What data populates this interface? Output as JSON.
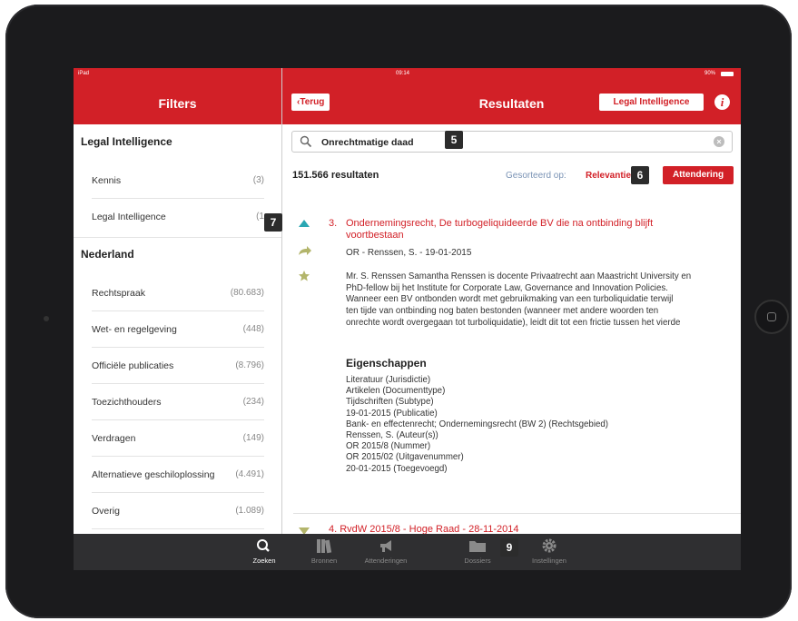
{
  "status": {
    "device": "iPad",
    "time": "09:14",
    "battery": "90%"
  },
  "left": {
    "title": "Filters",
    "sections": [
      {
        "heading": "Legal Intelligence",
        "items": [
          {
            "label": "Kennis",
            "count": "(3)"
          },
          {
            "label": "Legal Intelligence",
            "count": "(1"
          }
        ]
      },
      {
        "heading": "Nederland",
        "items": [
          {
            "label": "Rechtspraak",
            "count": "(80.683)"
          },
          {
            "label": "Wet- en regelgeving",
            "count": "(448)"
          },
          {
            "label": "Officiële publicaties",
            "count": "(8.796)"
          },
          {
            "label": "Toezichthouders",
            "count": "(234)"
          },
          {
            "label": "Verdragen",
            "count": "(149)"
          },
          {
            "label": "Alternatieve geschiloplossing",
            "count": "(4.491)"
          },
          {
            "label": "Overig",
            "count": "(1.089)"
          }
        ]
      }
    ]
  },
  "header": {
    "back": "‹Terug",
    "title": "Resultaten",
    "legal_intelligence": "Legal Intelligence",
    "info": "i"
  },
  "search": {
    "value": "Onrechtmatige daad"
  },
  "results": {
    "count": "151.566 resultaten",
    "sorted_label": "Gesorteerd op:",
    "sorted_value": "Relevantie",
    "attendering": "Attendering",
    "item": {
      "number": "3.",
      "title": "Ondernemingsrecht, De turbogeliquideerde BV die na ontbinding blijft voortbestaan",
      "meta": "OR - Renssen, S. - 19-01-2015",
      "snippet": [
        "Mr. S. Renssen Samantha Renssen is docente Privaatrecht aan Maastricht University en",
        "PhD-fellow bij het Institute for Corporate Law, Governance and Innovation Policies.",
        "Wanneer een BV ontbonden wordt met gebruikmaking van een turboliquidatie terwijl",
        "ten tijde van ontbinding nog baten bestonden (wanneer met andere woorden ten",
        "onrechte wordt overgegaan tot turboliquidatie), leidt dit tot een frictie tussen het vierde"
      ],
      "properties_heading": "Eigenschappen",
      "properties": [
        "Literatuur (Jurisdictie)",
        "Artikelen (Documenttype)",
        "Tijdschriften (Subtype)",
        "19-01-2015 (Publicatie)",
        "Bank- en effectenrecht; Ondernemingsrecht (BW 2) (Rechtsgebied)",
        "Renssen, S. (Auteur(s))",
        "OR 2015/8 (Nummer)",
        "OR 2015/02 (Uitgavenummer)",
        "20-01-2015 (Toegevoegd)"
      ]
    },
    "next_item": "4.  RvdW 2015/8 - Hoge Raad - 28-11-2014"
  },
  "tabs": [
    {
      "label": "Zoeken",
      "icon": "search-icon",
      "active": true
    },
    {
      "label": "Bronnen",
      "icon": "books-icon",
      "active": false
    },
    {
      "label": "Attenderingen",
      "icon": "megaphone-icon",
      "active": false
    },
    {
      "label": "Dossiers",
      "icon": "folder-icon",
      "active": false
    },
    {
      "label": "Instellingen",
      "icon": "gear-icon",
      "active": false
    }
  ],
  "callouts": [
    "5",
    "6",
    "7",
    "9"
  ],
  "colors": {
    "brand_red": "#d22027",
    "tabbar": "#2f2f31",
    "teal": "#2aa7b3",
    "olive": "#b3b56b"
  }
}
